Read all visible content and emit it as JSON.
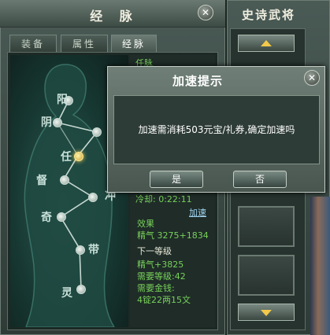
{
  "main_panel": {
    "title": "经 脉"
  },
  "tabs": [
    {
      "label": "装备"
    },
    {
      "label": "属性"
    },
    {
      "label": "经脉"
    }
  ],
  "meridian_nodes": [
    {
      "label": "阳"
    },
    {
      "label": "阴"
    },
    {
      "label": "任"
    },
    {
      "label": "督"
    },
    {
      "label": "冲"
    },
    {
      "label": "奇"
    },
    {
      "label": "带"
    },
    {
      "label": "灵"
    }
  ],
  "info": {
    "top_label": "任脉",
    "timer": "冷却: 0:22:11",
    "accelerate_link": "加速",
    "effect_title": "效果",
    "effect_value": "精气  3275+1834",
    "next_level_title": "下一等级",
    "next_qi": "精气+3825",
    "required_level": "需要等级:42",
    "required_money_label": "需要金钱:",
    "required_money": "4锭22两15文"
  },
  "right_panel": {
    "title": "史诗武将"
  },
  "dialog": {
    "title": "加速提示",
    "message": "加速需消耗503元宝/礼券,确定加速吗",
    "yes_label": "是",
    "no_label": "否"
  },
  "colors": {
    "accent_gold": "#f4c94a",
    "green_text": "#78d05a",
    "panel": "#4a5a55"
  }
}
